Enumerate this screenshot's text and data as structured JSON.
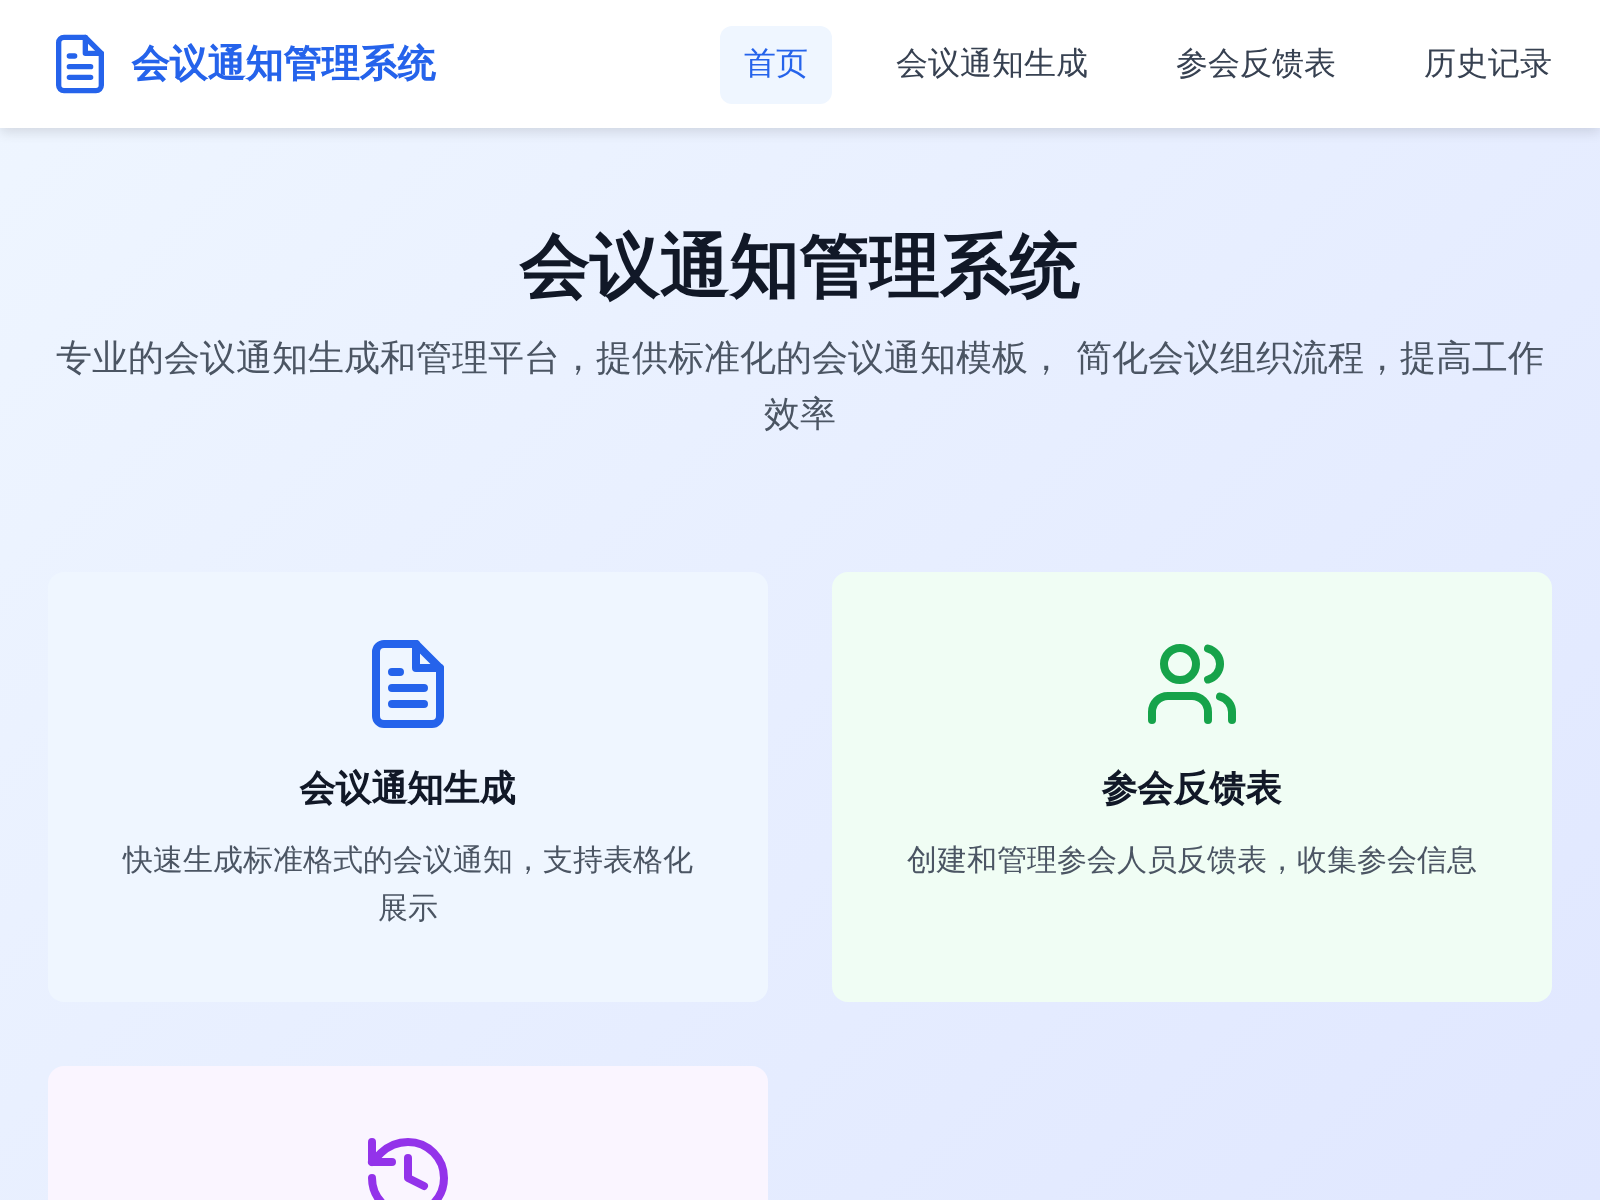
{
  "header": {
    "title": "会议通知管理系统"
  },
  "nav": [
    {
      "label": "首页",
      "selected": true
    },
    {
      "label": "会议通知生成",
      "selected": false
    },
    {
      "label": "参会反馈表",
      "selected": false
    },
    {
      "label": "历史记录",
      "selected": false
    }
  ],
  "hero": {
    "title": "会议通知管理系统",
    "subtitle": "专业的会议通知生成和管理平台，提供标准化的会议通知模板， 简化会议组织流程，提高工作效率"
  },
  "cards": [
    {
      "kind": "document",
      "color": "#2563eb",
      "title": "会议通知生成",
      "description": "快速生成标准格式的会议通知，支持表格化展示"
    },
    {
      "kind": "users",
      "color": "#16a34a",
      "title": "参会反馈表",
      "description": "创建和管理参会人员反馈表，收集参会信息"
    },
    {
      "kind": "history",
      "color": "#9333ea"
    }
  ]
}
